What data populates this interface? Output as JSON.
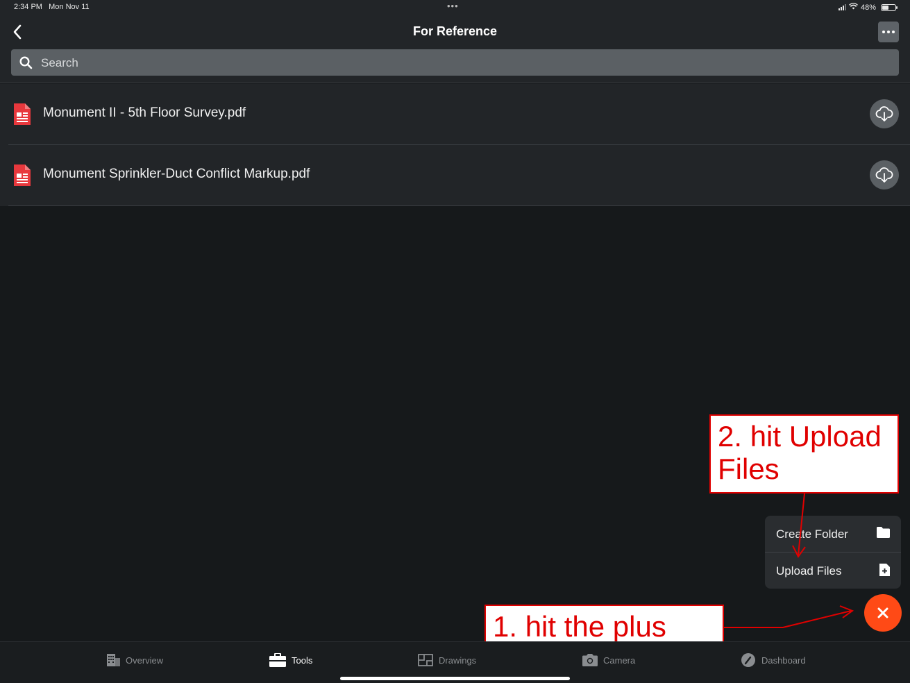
{
  "status_bar": {
    "time": "2:34 PM",
    "date": "Mon Nov 11",
    "battery": "48%",
    "dots": "•••"
  },
  "header": {
    "title": "For Reference"
  },
  "search": {
    "placeholder": "Search"
  },
  "files": [
    {
      "name": "Monument II - 5th Floor Survey.pdf",
      "icon": "pdf-file-icon",
      "action_icon": "cloud-download-icon"
    },
    {
      "name": "Monument Sprinkler-Duct Conflict Markup.pdf",
      "icon": "pdf-file-icon",
      "action_icon": "cloud-download-icon"
    }
  ],
  "menu": {
    "create_folder": "Create Folder",
    "upload_files": "Upload Files"
  },
  "annotations": {
    "step2_line1": "2. hit Upload",
    "step2_line2": "Files",
    "step1": "1. hit the plus"
  },
  "tabs": [
    {
      "label": "Overview",
      "icon": "building-icon",
      "active": false
    },
    {
      "label": "Tools",
      "icon": "toolbox-icon",
      "active": true
    },
    {
      "label": "Drawings",
      "icon": "floorplan-icon",
      "active": false
    },
    {
      "label": "Camera",
      "icon": "camera-icon",
      "active": false
    },
    {
      "label": "Dashboard",
      "icon": "gauge-icon",
      "active": false
    }
  ],
  "colors": {
    "background": "#16191b",
    "surface": "#222528",
    "fab": "#ff4a16",
    "pdf_red": "#e8383d",
    "annotation_red": "#e00000"
  }
}
